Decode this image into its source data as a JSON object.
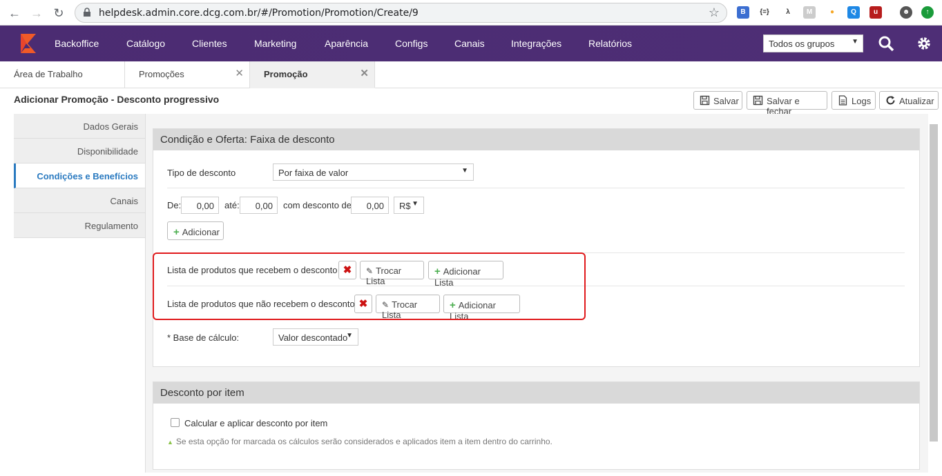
{
  "browser": {
    "url": "helpdesk.admin.core.dcg.com.br/#/Promotion/Promotion/Create/9"
  },
  "topnav": {
    "menu": [
      "Backoffice",
      "Catálogo",
      "Clientes",
      "Marketing",
      "Aparência",
      "Configs",
      "Canais",
      "Integrações",
      "Relatórios"
    ],
    "group_select": "Todos os grupos",
    "brand_color": "#4c2d73"
  },
  "tabs": [
    {
      "label": "Área de Trabalho"
    },
    {
      "label": "Promoções"
    },
    {
      "label": "Promoção"
    }
  ],
  "header": {
    "title": "Adicionar Promoção - Desconto progressivo",
    "buttons": {
      "save": "Salvar",
      "save_close": "Salvar e fechar",
      "logs": "Logs",
      "refresh": "Atualizar"
    }
  },
  "sidebar": {
    "items": [
      "Dados Gerais",
      "Disponibilidade",
      "Condições e Benefícios",
      "Canais",
      "Regulamento"
    ]
  },
  "panel1": {
    "title": "Condição e Oferta: Faixa de desconto",
    "discount_type_label": "Tipo de desconto",
    "discount_type_value": "Por faixa de valor",
    "from_label": "De:",
    "from_value": "0,00",
    "to_label": "até:",
    "to_value": "0,00",
    "with_discount_label": "com desconto de:",
    "discount_value": "0,00",
    "currency": "R$",
    "add_label": "Adicionar",
    "list1_label": "Lista de produtos que recebem o desconto",
    "list2_label": "Lista de produtos que não recebem o desconto",
    "swap_list": "Trocar Lista",
    "add_list": "Adicionar Lista",
    "base_label": "* Base de cálculo:",
    "base_value": "Valor descontado"
  },
  "panel2": {
    "title": "Desconto por item",
    "checkbox_label": "Calcular e aplicar desconto por item",
    "hint": "Se esta opção for marcada os cálculos serão considerados e aplicados item a item dentro do carrinho."
  }
}
